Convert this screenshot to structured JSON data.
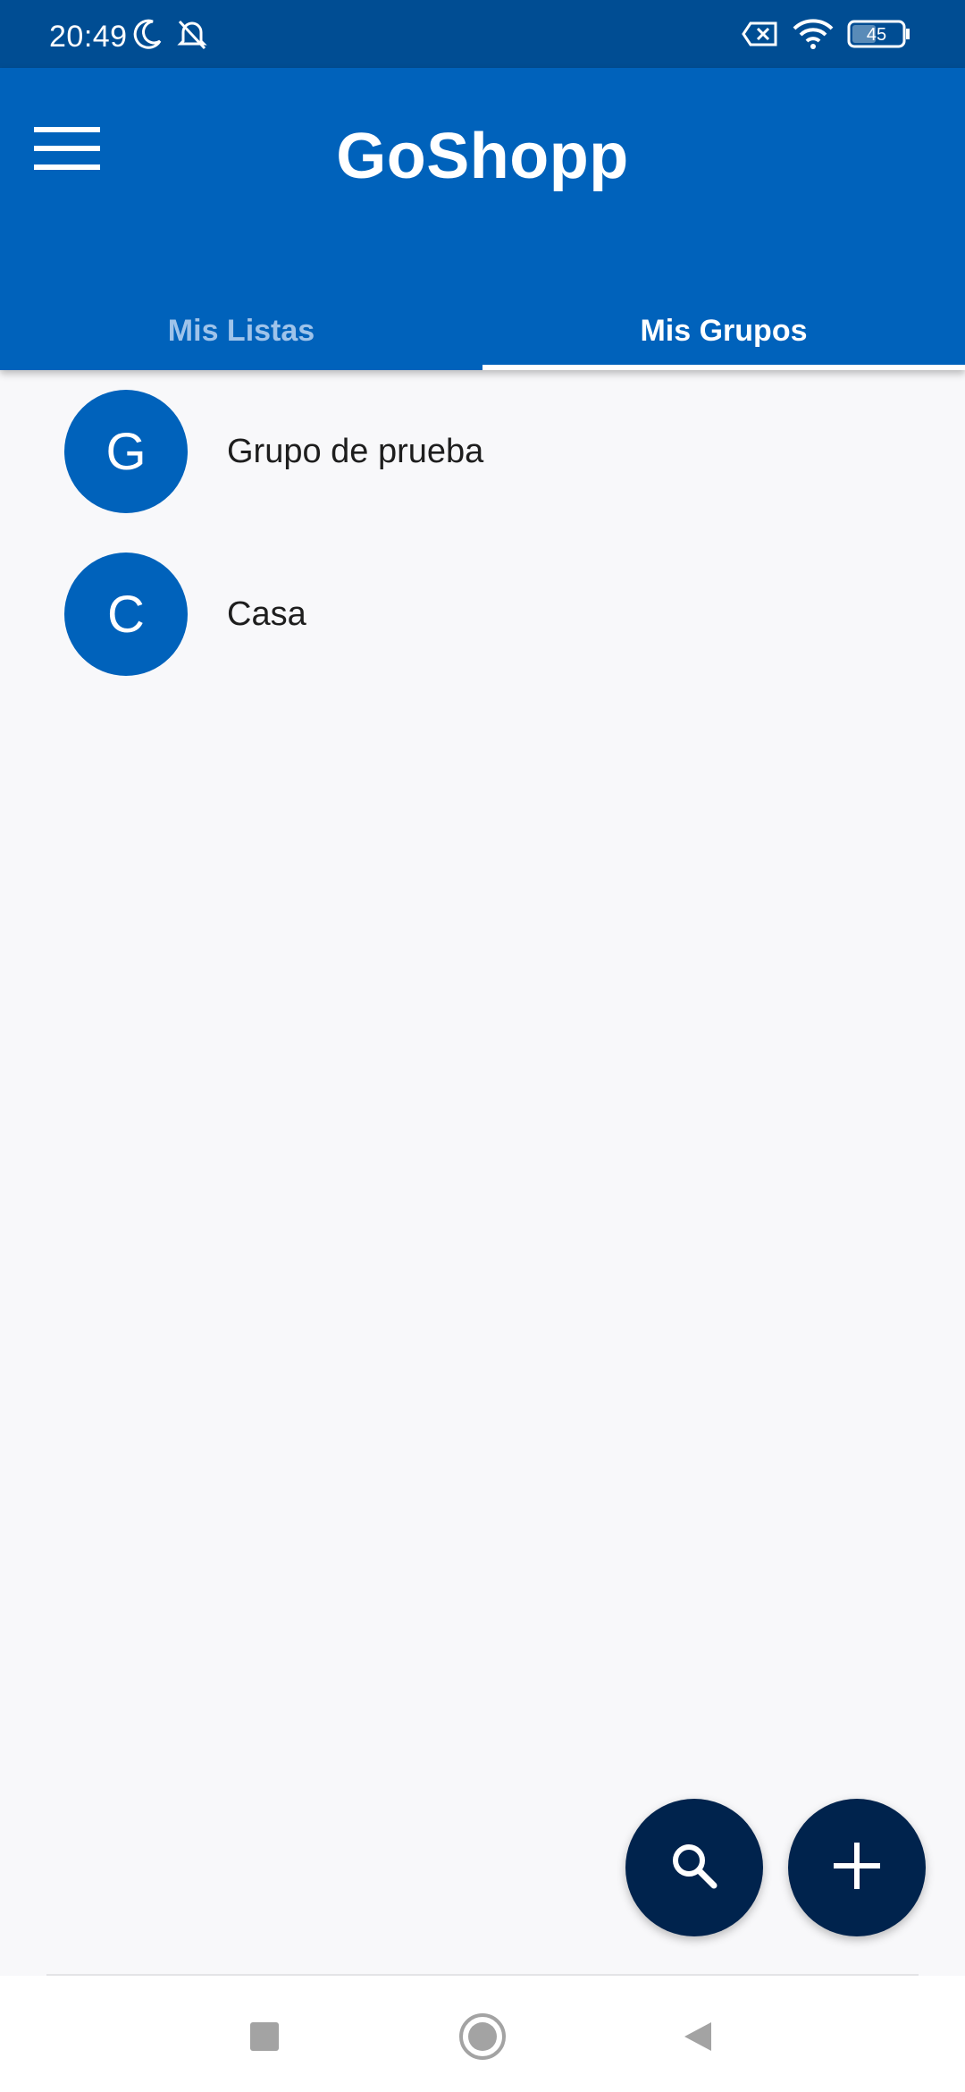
{
  "status_bar": {
    "time": "20:49",
    "battery": "45",
    "icons": [
      "moon-icon",
      "bell-off-icon",
      "sim-off-icon",
      "wifi-icon",
      "battery-icon"
    ]
  },
  "app_bar": {
    "title": "GoShopp",
    "menu_icon": "hamburger-menu-icon"
  },
  "tabs": [
    {
      "label": "Mis Listas",
      "selected": false
    },
    {
      "label": "Mis Grupos",
      "selected": true
    }
  ],
  "groups": [
    {
      "initial": "G",
      "name": "Grupo de prueba"
    },
    {
      "initial": "C",
      "name": "Casa"
    }
  ],
  "fabs": {
    "search_icon": "search-icon",
    "add_icon": "plus-icon"
  },
  "nav": {
    "icons": [
      "recents-square-icon",
      "home-circle-icon",
      "back-triangle-icon"
    ]
  },
  "colors": {
    "status_bar": "#004d93",
    "primary": "#0062bb",
    "fab": "#00234d",
    "background": "#f8f8fa",
    "tab_inactive": "#9ec3ea"
  }
}
